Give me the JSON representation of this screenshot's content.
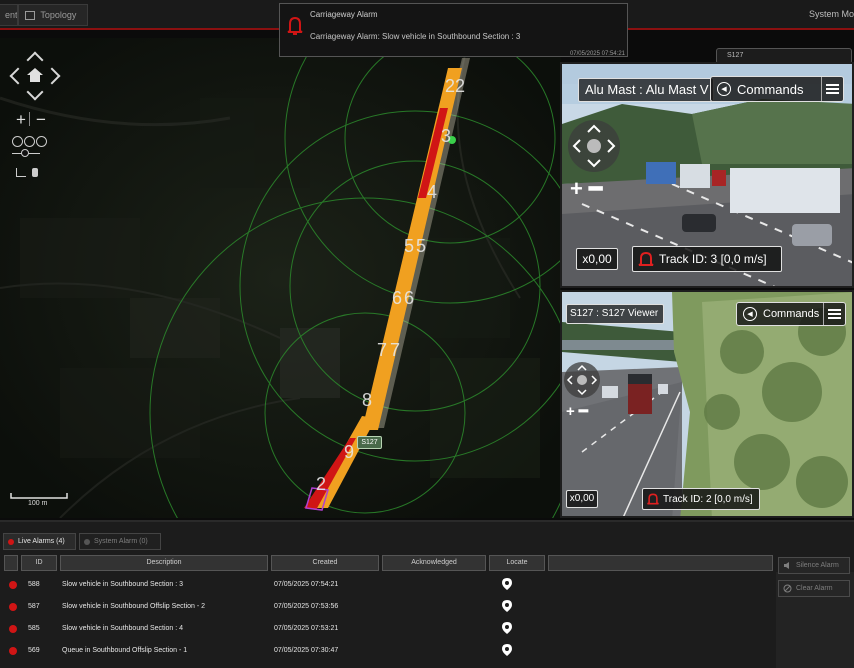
{
  "topbar": {
    "tab_event": "ent",
    "tab_topology": "Topology",
    "system_mode": "System Mo"
  },
  "toast": {
    "title": "Carriageway Alarm",
    "message": "Carriageway Alarm: Slow vehicle in Southbound Section : 3",
    "timestamp": "07/05/2025 07:54:21"
  },
  "map": {
    "section_labels": [
      "22",
      "3",
      "4",
      "5",
      "5",
      "6",
      "6",
      "7",
      "7",
      "8",
      "9",
      "2"
    ],
    "sensor_tag": "S127",
    "scale_label": "100 m",
    "zoom_in": "+",
    "zoom_out": "−"
  },
  "camera_header": {
    "label": "S127"
  },
  "camera1": {
    "title": "Alu Mast : Alu Mast V",
    "commands_label": "Commands",
    "zoom": "x0,00",
    "track": "Track ID: 3 [0,0 m/s]"
  },
  "camera2": {
    "title": "S127 : S127 Viewer",
    "commands_label": "Commands",
    "zoom": "x0,00",
    "track": "Track ID: 2 [0,0 m/s]"
  },
  "alarms": {
    "tabs": [
      {
        "label": "Live Alarms (4)",
        "color": "#d01515"
      },
      {
        "label": "System Alarm (0)",
        "color": "#555555"
      }
    ],
    "columns": [
      "",
      "ID",
      "Description",
      "Created",
      "Acknowledged",
      "Locate",
      ""
    ],
    "rows": [
      {
        "id": "588",
        "description": "Slow vehicle in Southbound Section : 3",
        "created": "07/05/2025 07:54:21"
      },
      {
        "id": "587",
        "description": "Slow vehicle in Southbound Offslip Section - 2",
        "created": "07/05/2025 07:53:56"
      },
      {
        "id": "585",
        "description": "Slow vehicle in Southbound Section : 4",
        "created": "07/05/2025 07:53:21"
      },
      {
        "id": "569",
        "description": "Queue in Southbound Offslip Section - 1",
        "created": "07/05/2025 07:30:47"
      }
    ],
    "silence_label": "Silence Alarm",
    "clear_label": "Clear Alarm"
  },
  "colors": {
    "alarm_red": "#d01515",
    "accent_red": "#8b1010",
    "ring_green": "#2c8a2c",
    "road_orange": "#f0a020"
  },
  "icons": [
    "bell-icon",
    "home-icon",
    "locate-pin-icon",
    "commands-icon",
    "menu-icon",
    "speaker-icon",
    "clear-icon",
    "topology-icon"
  ]
}
